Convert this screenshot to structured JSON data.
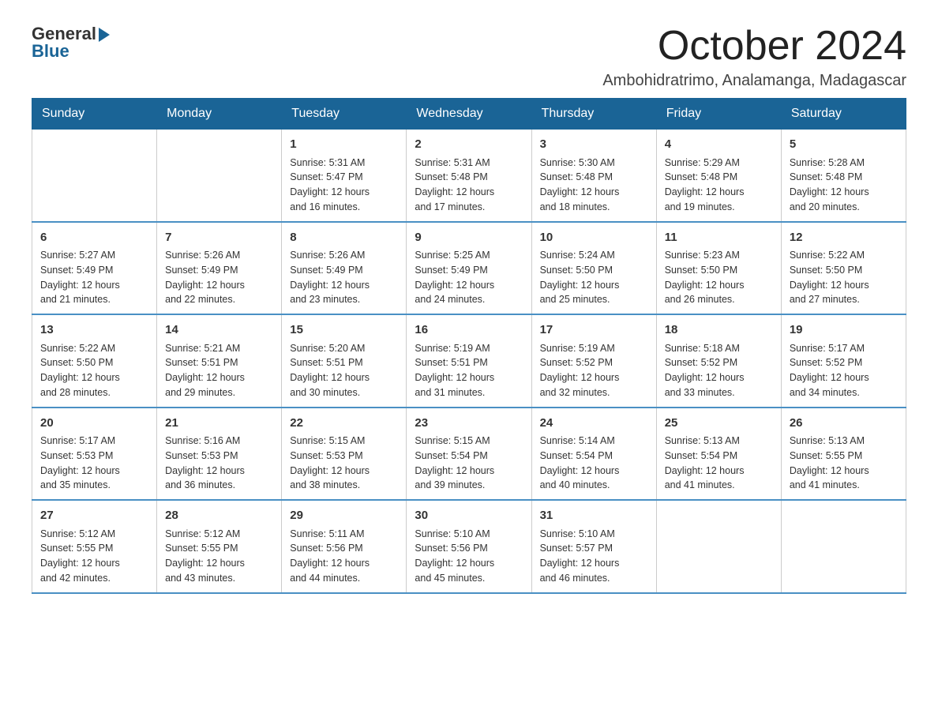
{
  "logo": {
    "general": "General",
    "blue": "Blue"
  },
  "header": {
    "month": "October 2024",
    "location": "Ambohidratrimo, Analamanga, Madagascar"
  },
  "weekdays": [
    "Sunday",
    "Monday",
    "Tuesday",
    "Wednesday",
    "Thursday",
    "Friday",
    "Saturday"
  ],
  "weeks": [
    [
      {
        "day": "",
        "info": ""
      },
      {
        "day": "",
        "info": ""
      },
      {
        "day": "1",
        "info": "Sunrise: 5:31 AM\nSunset: 5:47 PM\nDaylight: 12 hours\nand 16 minutes."
      },
      {
        "day": "2",
        "info": "Sunrise: 5:31 AM\nSunset: 5:48 PM\nDaylight: 12 hours\nand 17 minutes."
      },
      {
        "day": "3",
        "info": "Sunrise: 5:30 AM\nSunset: 5:48 PM\nDaylight: 12 hours\nand 18 minutes."
      },
      {
        "day": "4",
        "info": "Sunrise: 5:29 AM\nSunset: 5:48 PM\nDaylight: 12 hours\nand 19 minutes."
      },
      {
        "day": "5",
        "info": "Sunrise: 5:28 AM\nSunset: 5:48 PM\nDaylight: 12 hours\nand 20 minutes."
      }
    ],
    [
      {
        "day": "6",
        "info": "Sunrise: 5:27 AM\nSunset: 5:49 PM\nDaylight: 12 hours\nand 21 minutes."
      },
      {
        "day": "7",
        "info": "Sunrise: 5:26 AM\nSunset: 5:49 PM\nDaylight: 12 hours\nand 22 minutes."
      },
      {
        "day": "8",
        "info": "Sunrise: 5:26 AM\nSunset: 5:49 PM\nDaylight: 12 hours\nand 23 minutes."
      },
      {
        "day": "9",
        "info": "Sunrise: 5:25 AM\nSunset: 5:49 PM\nDaylight: 12 hours\nand 24 minutes."
      },
      {
        "day": "10",
        "info": "Sunrise: 5:24 AM\nSunset: 5:50 PM\nDaylight: 12 hours\nand 25 minutes."
      },
      {
        "day": "11",
        "info": "Sunrise: 5:23 AM\nSunset: 5:50 PM\nDaylight: 12 hours\nand 26 minutes."
      },
      {
        "day": "12",
        "info": "Sunrise: 5:22 AM\nSunset: 5:50 PM\nDaylight: 12 hours\nand 27 minutes."
      }
    ],
    [
      {
        "day": "13",
        "info": "Sunrise: 5:22 AM\nSunset: 5:50 PM\nDaylight: 12 hours\nand 28 minutes."
      },
      {
        "day": "14",
        "info": "Sunrise: 5:21 AM\nSunset: 5:51 PM\nDaylight: 12 hours\nand 29 minutes."
      },
      {
        "day": "15",
        "info": "Sunrise: 5:20 AM\nSunset: 5:51 PM\nDaylight: 12 hours\nand 30 minutes."
      },
      {
        "day": "16",
        "info": "Sunrise: 5:19 AM\nSunset: 5:51 PM\nDaylight: 12 hours\nand 31 minutes."
      },
      {
        "day": "17",
        "info": "Sunrise: 5:19 AM\nSunset: 5:52 PM\nDaylight: 12 hours\nand 32 minutes."
      },
      {
        "day": "18",
        "info": "Sunrise: 5:18 AM\nSunset: 5:52 PM\nDaylight: 12 hours\nand 33 minutes."
      },
      {
        "day": "19",
        "info": "Sunrise: 5:17 AM\nSunset: 5:52 PM\nDaylight: 12 hours\nand 34 minutes."
      }
    ],
    [
      {
        "day": "20",
        "info": "Sunrise: 5:17 AM\nSunset: 5:53 PM\nDaylight: 12 hours\nand 35 minutes."
      },
      {
        "day": "21",
        "info": "Sunrise: 5:16 AM\nSunset: 5:53 PM\nDaylight: 12 hours\nand 36 minutes."
      },
      {
        "day": "22",
        "info": "Sunrise: 5:15 AM\nSunset: 5:53 PM\nDaylight: 12 hours\nand 38 minutes."
      },
      {
        "day": "23",
        "info": "Sunrise: 5:15 AM\nSunset: 5:54 PM\nDaylight: 12 hours\nand 39 minutes."
      },
      {
        "day": "24",
        "info": "Sunrise: 5:14 AM\nSunset: 5:54 PM\nDaylight: 12 hours\nand 40 minutes."
      },
      {
        "day": "25",
        "info": "Sunrise: 5:13 AM\nSunset: 5:54 PM\nDaylight: 12 hours\nand 41 minutes."
      },
      {
        "day": "26",
        "info": "Sunrise: 5:13 AM\nSunset: 5:55 PM\nDaylight: 12 hours\nand 41 minutes."
      }
    ],
    [
      {
        "day": "27",
        "info": "Sunrise: 5:12 AM\nSunset: 5:55 PM\nDaylight: 12 hours\nand 42 minutes."
      },
      {
        "day": "28",
        "info": "Sunrise: 5:12 AM\nSunset: 5:55 PM\nDaylight: 12 hours\nand 43 minutes."
      },
      {
        "day": "29",
        "info": "Sunrise: 5:11 AM\nSunset: 5:56 PM\nDaylight: 12 hours\nand 44 minutes."
      },
      {
        "day": "30",
        "info": "Sunrise: 5:10 AM\nSunset: 5:56 PM\nDaylight: 12 hours\nand 45 minutes."
      },
      {
        "day": "31",
        "info": "Sunrise: 5:10 AM\nSunset: 5:57 PM\nDaylight: 12 hours\nand 46 minutes."
      },
      {
        "day": "",
        "info": ""
      },
      {
        "day": "",
        "info": ""
      }
    ]
  ]
}
